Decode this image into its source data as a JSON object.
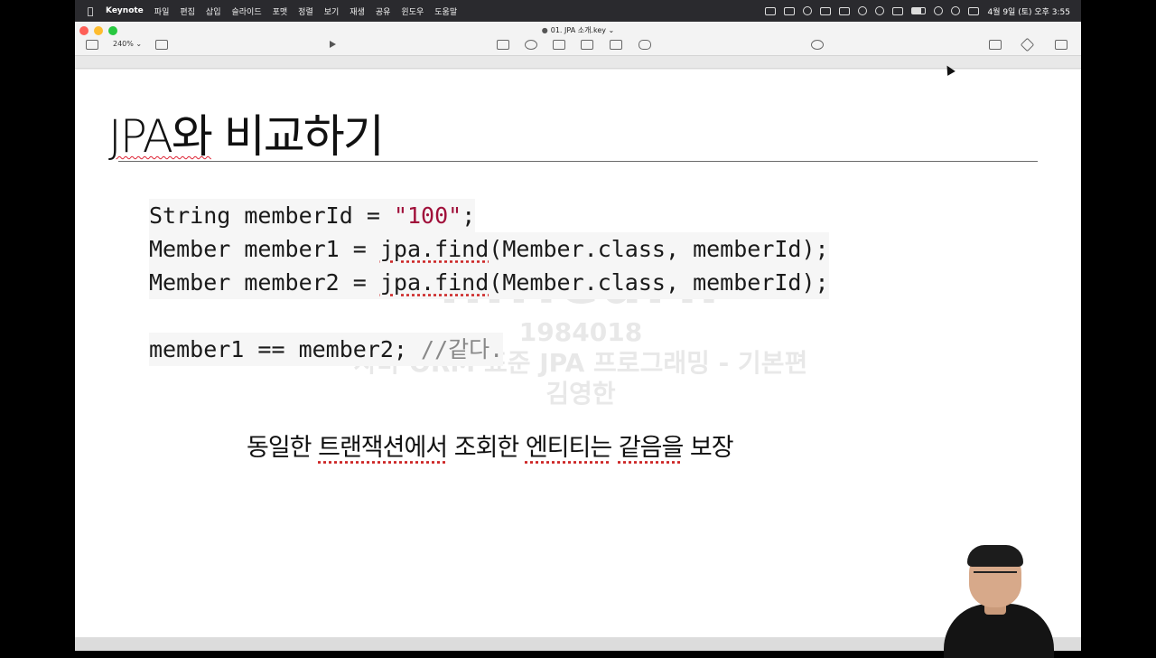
{
  "menubar": {
    "app": "Keynote",
    "items": [
      "파일",
      "편집",
      "삽입",
      "슬라이드",
      "포맷",
      "정렬",
      "보기",
      "재생",
      "공유",
      "윈도우",
      "도움말"
    ],
    "clock": "4월 9일 (토) 오후 3:55"
  },
  "toolbar": {
    "doc_title": "01. JPA 소개.key",
    "zoom": "240%"
  },
  "slide": {
    "title_prefix": "JPA와",
    "title_rest": " 비교하기",
    "code": {
      "line1_a": "String memberId = ",
      "line1_str": "\"100\"",
      "line1_b": ";",
      "line2_a": "Member member1 = ",
      "line2_sq": "jpa.find",
      "line2_b": "(Member.class, memberId);",
      "line3_a": "Member member2 = ",
      "line3_sq": "jpa.find",
      "line3_b": "(Member.class, memberId);",
      "line4_a": "member1 == member2; ",
      "line4_comment": "//같다."
    },
    "statement": {
      "p1": "동일한 ",
      "p2": "트랜잭션에서",
      "p3": " 조회한 ",
      "p4": "엔티티는",
      "p5": " ",
      "p6": "같음을",
      "p7": " 보장"
    }
  },
  "watermark": {
    "logo": "inflearn",
    "line1": "1984018",
    "line2": "자바 ORM 표준 JPA 프로그래밍 - 기본편",
    "line3": "김영한"
  }
}
